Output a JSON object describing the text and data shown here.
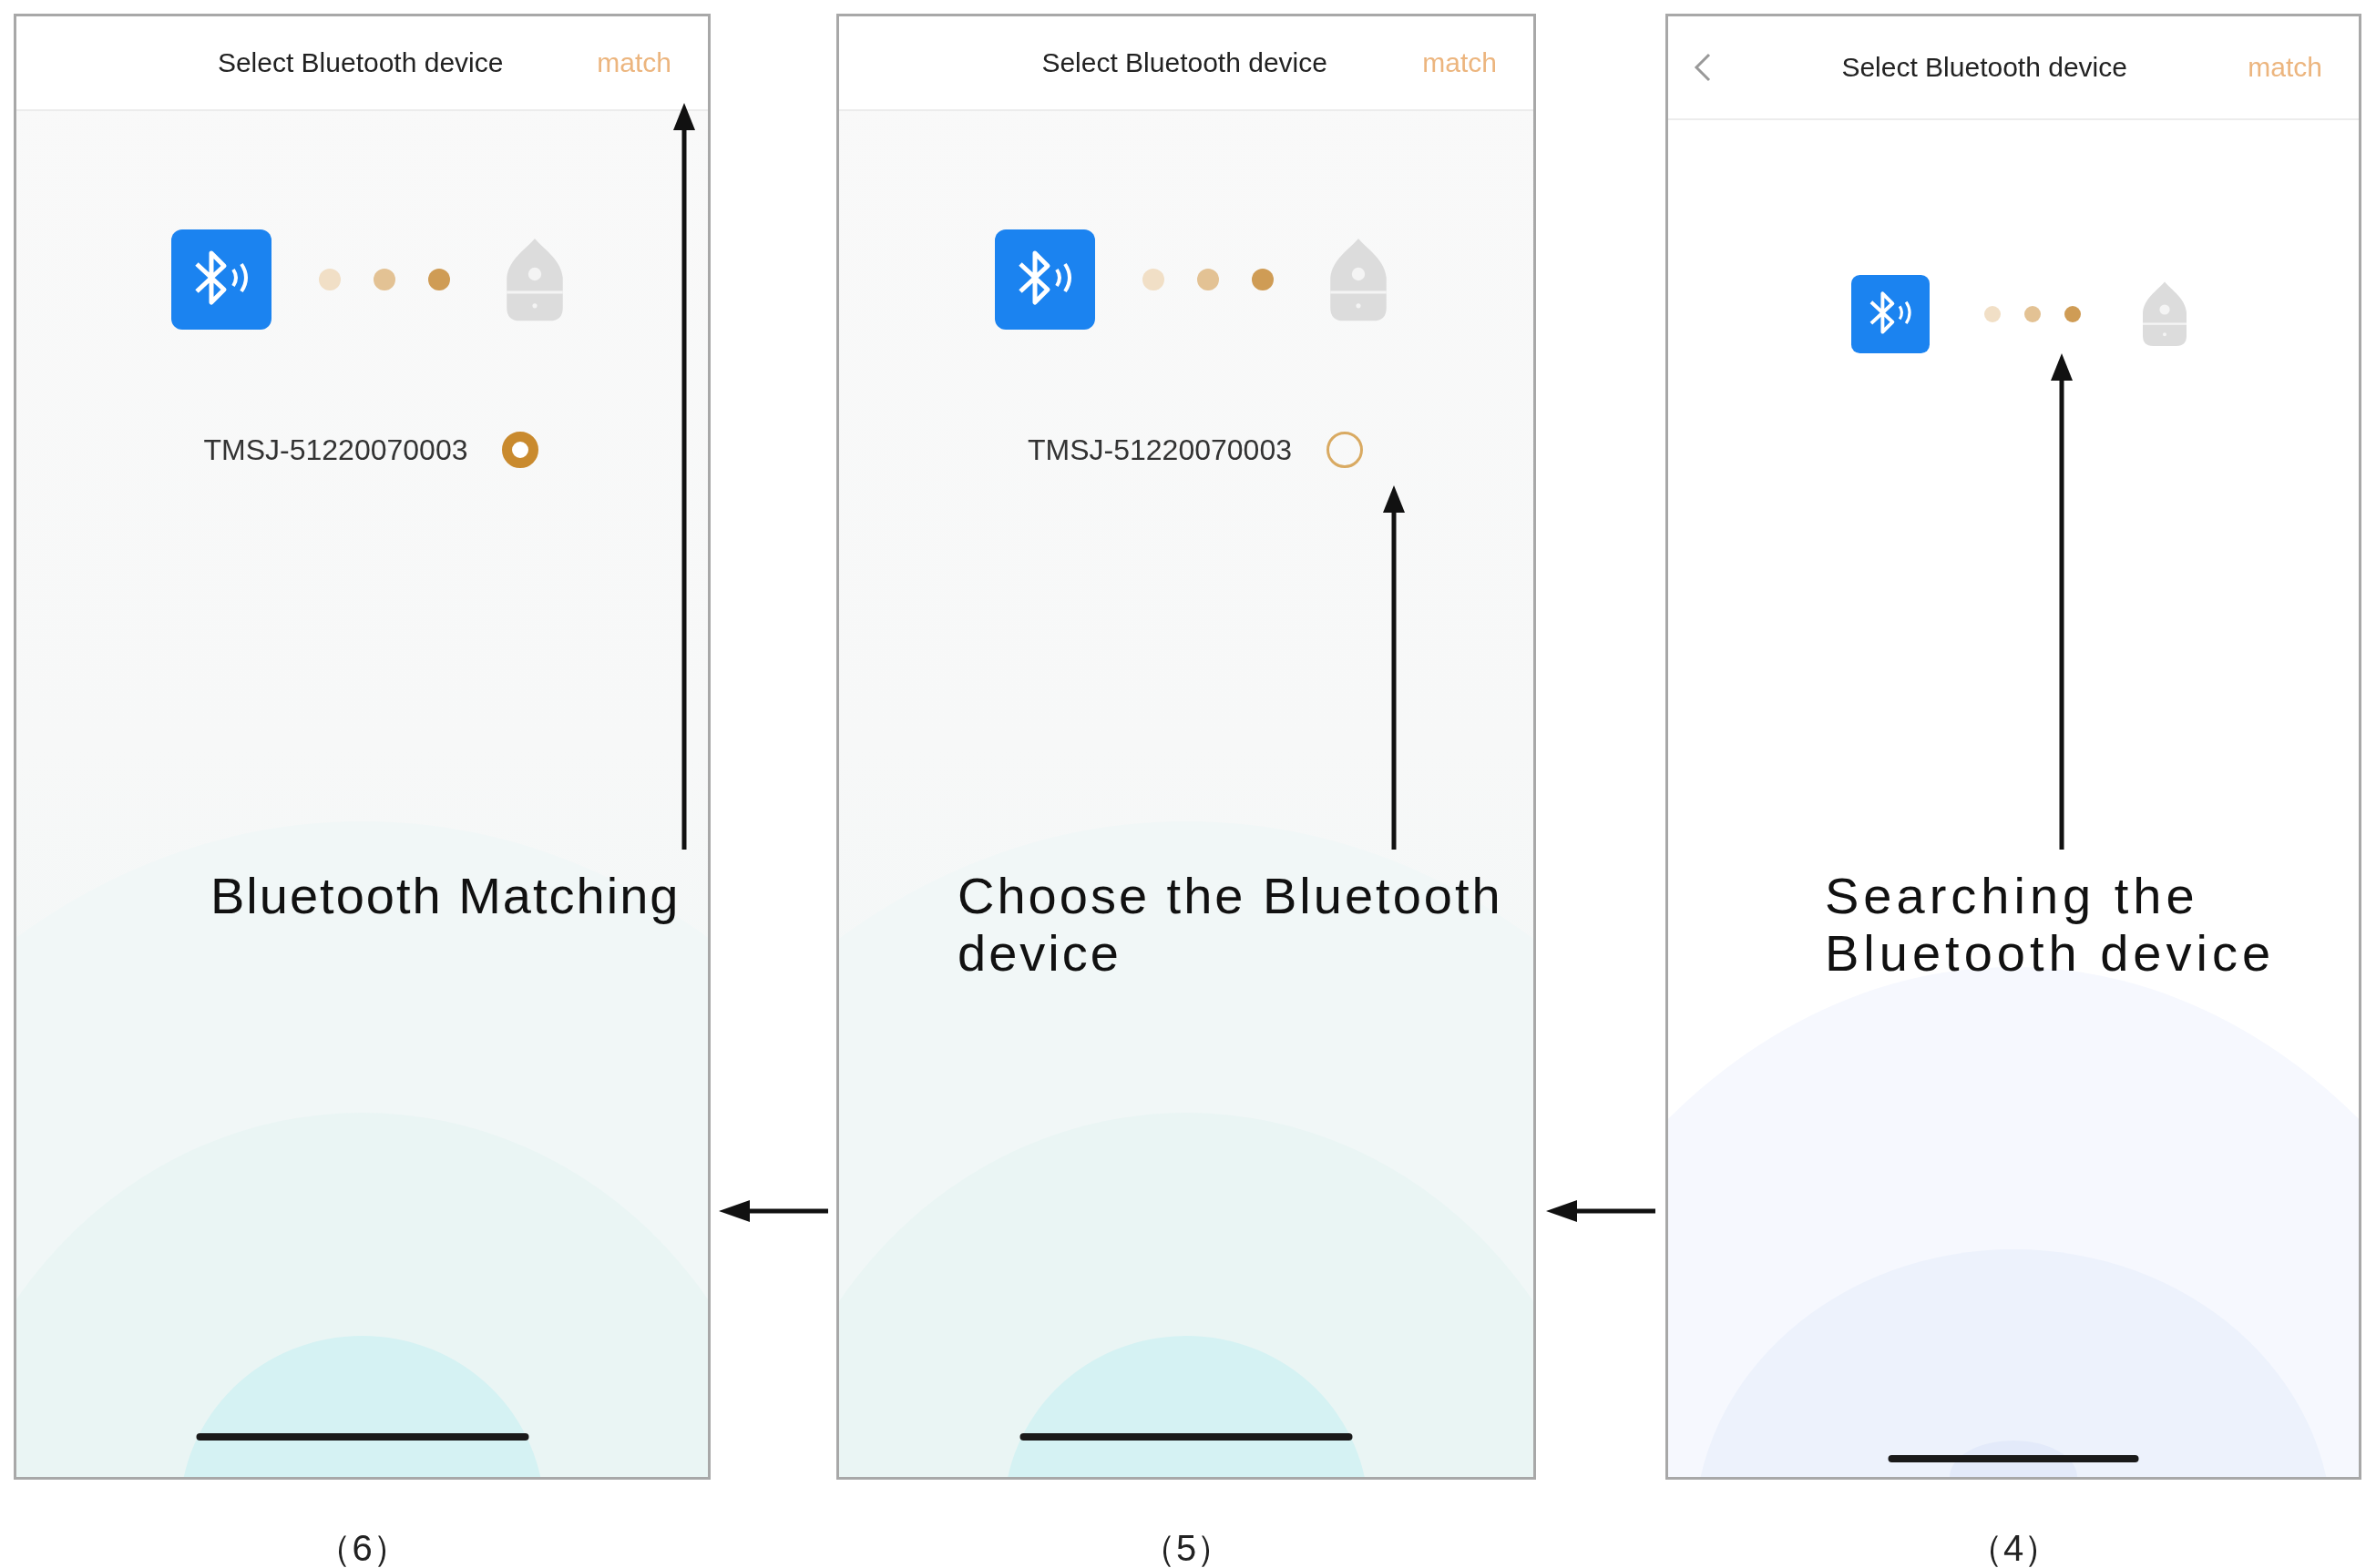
{
  "screens": [
    {
      "kind": "teal",
      "caption": "（6）",
      "header": {
        "back_button": false,
        "title": "Select Bluetooth device",
        "action": "match"
      },
      "device": {
        "name": "TMSJ-51220070003",
        "selected": true
      },
      "annotation": {
        "text": "Bluetooth Matching",
        "kind": "action"
      }
    },
    {
      "kind": "teal",
      "caption": "（5）",
      "header": {
        "back_button": false,
        "title": "Select Bluetooth device",
        "action": "match"
      },
      "device": {
        "name": "TMSJ-51220070003",
        "selected": false
      },
      "annotation": {
        "text": "Choose the Bluetooth device",
        "kind": "device"
      }
    },
    {
      "kind": "blue",
      "caption": "（4）",
      "header": {
        "back_button": true,
        "title": "Select Bluetooth device",
        "action": "match"
      },
      "annotation": {
        "text": "Searching the Bluetooth device",
        "kind": "dots"
      }
    }
  ]
}
